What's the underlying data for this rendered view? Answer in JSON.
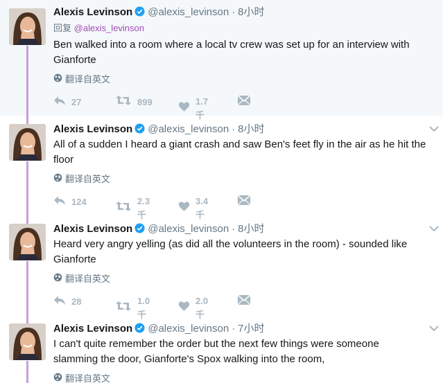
{
  "tweets": [
    {
      "name": "Alexis Levinson",
      "handle": "@alexis_levinson",
      "dot": "·",
      "time": "8小时",
      "reply_prefix": "回复",
      "reply_handle": "@alexis_levinson",
      "text_lines": [
        "Ben walked into a room where a local tv crew was set up for an interview with",
        "Gianforte"
      ],
      "translate": "翻译自英文",
      "replies": "27",
      "retweets": "899",
      "likes": "1.7千"
    },
    {
      "name": "Alexis Levinson",
      "handle": "@alexis_levinson",
      "dot": "·",
      "time": "8小时",
      "text_lines": [
        "All of a sudden I heard a giant crash and saw Ben's feet fly in the air as he hit the",
        "floor"
      ],
      "translate": "翻译自英文",
      "replies": "124",
      "retweets": "2.3千",
      "likes": "3.4千"
    },
    {
      "name": "Alexis Levinson",
      "handle": "@alexis_levinson",
      "dot": "·",
      "time": "8小时",
      "text_lines": [
        "Heard very angry yelling (as did all the volunteers in the room) - sounded like",
        "Gianforte"
      ],
      "translate": "翻译自英文",
      "replies": "28",
      "retweets": "1.0千",
      "likes": "2.0千"
    },
    {
      "name": "Alexis Levinson",
      "handle": "@alexis_levinson",
      "dot": "·",
      "time": "7小时",
      "text_lines": [
        "I can't quite remember the order but the next few things were someone",
        "slamming the door, Gianforte's Spox walking into the room,"
      ],
      "translate": "翻译自英文"
    }
  ],
  "colors": {
    "thread_line": "#c99ddb",
    "reply_link": "#a24ab5",
    "verified": "#1da1f2",
    "icon_gray": "#aab8c2",
    "first_bg": "#f5f8fa"
  },
  "icons": {
    "verified": "verified-badge-icon",
    "chevron": "chevron-down-icon",
    "globe": "globe-icon",
    "reply": "reply-icon",
    "retweet": "retweet-icon",
    "like": "heart-icon",
    "dm": "envelope-icon"
  }
}
